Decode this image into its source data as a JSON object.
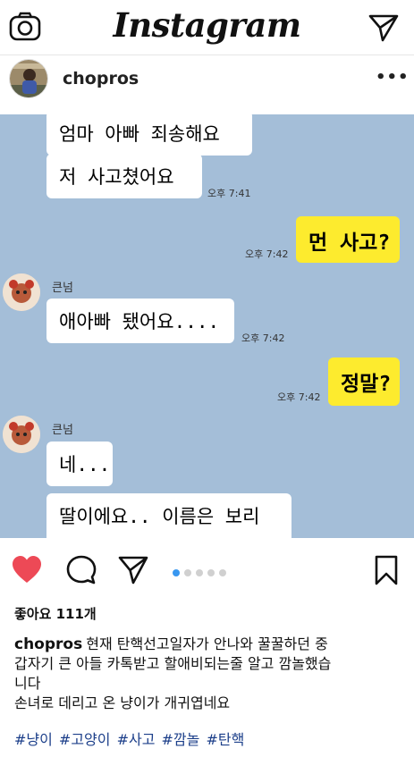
{
  "topbar": {
    "brand": "Instagram",
    "camera_icon": "camera-icon",
    "send_icon": "direct-message-icon"
  },
  "post": {
    "username": "chopros",
    "more": "•••"
  },
  "chat": [
    {
      "text": "엄마 아빠 죄송해요",
      "from": "them"
    },
    {
      "text": "저 사고쳤어요",
      "from": "them",
      "time": "오후 7:41"
    },
    {
      "text": "먼 사고?",
      "from": "me",
      "time": "오후 7:42"
    },
    {
      "sender": "큰넘"
    },
    {
      "text": "애아빠 됐어요....",
      "from": "them",
      "time": "오후 7:42"
    },
    {
      "text": "정말?",
      "from": "me",
      "time": "오후 7:42"
    },
    {
      "sender": "큰넘"
    },
    {
      "text": "네...",
      "from": "them"
    },
    {
      "text": "딸이에요.. 이름은 보리",
      "from": "them"
    }
  ],
  "carousel": {
    "count": 5,
    "active": 0
  },
  "accent": "#3897f0",
  "like_color": "#ed4956",
  "likes": "좋아요 111개",
  "caption": {
    "username": "chopros",
    "line1": "현재 탄핵선고일자가 안나와 꿀꿀하던 중",
    "line2": "갑자기 큰 아들 카톡받고 할애비되는줄 알고 깜놀했습",
    "line3": "니다",
    "line4": "손녀로 데리고 온 냥이가 개귀엽네요"
  },
  "hashtags": "#냥이 #고양이 #사고 #깜놀 #탄핵"
}
